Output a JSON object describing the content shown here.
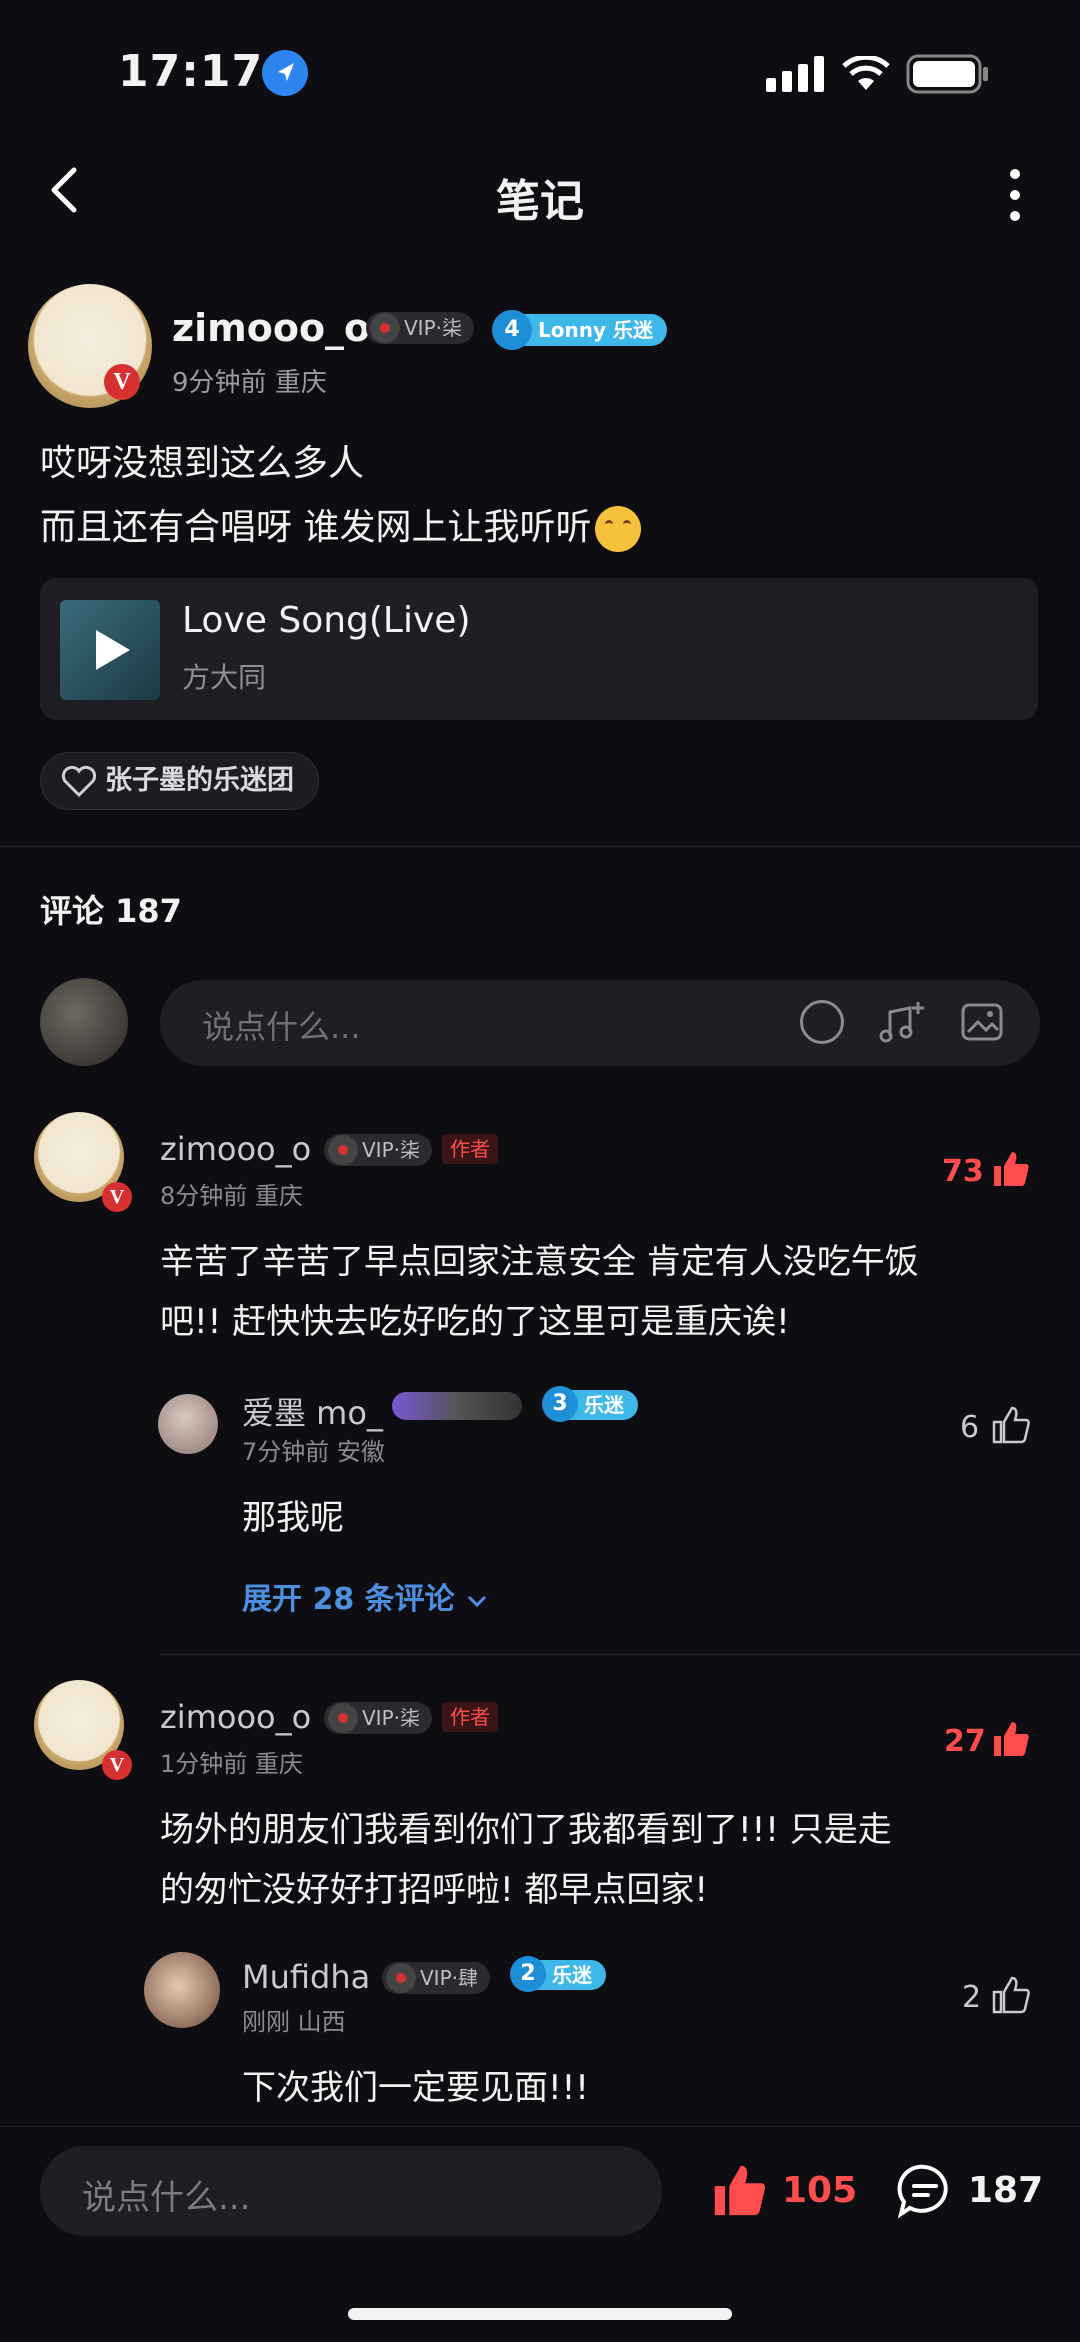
{
  "status_bar": {
    "time": "17:17"
  },
  "nav": {
    "title": "笔记"
  },
  "post": {
    "author": "zimooo_o",
    "vip": "VIP·柒",
    "fan_level": "4",
    "fan_label": "Lonny 乐迷",
    "time": "9分钟前",
    "location": "重庆",
    "line1": "哎呀没想到这么多人",
    "line2": "而且还有合唱呀 谁发网上让我听听",
    "song": {
      "name": "Love Song(Live)",
      "artist": "方大同"
    },
    "fan_group": "张子墨的乐迷团"
  },
  "comments_header": {
    "label": "评论 187"
  },
  "comment_input": {
    "placeholder": "说点什么..."
  },
  "comments": [
    {
      "author": "zimooo_o",
      "vip": "VIP·柒",
      "tag": "作者",
      "time": "8分钟前",
      "location": "重庆",
      "likes": "73",
      "line1": "辛苦了辛苦了早点回家注意安全 肯定有人没吃午饭",
      "line2": "吧!! 赶快快去吃好吃的了这里可是重庆诶!",
      "reply": {
        "author": "爱墨 mo_",
        "fan_level": "3",
        "fan_label": "乐迷",
        "time": "7分钟前",
        "location": "安徽",
        "likes": "6",
        "text": "那我呢"
      },
      "expand": "展开 28 条评论"
    },
    {
      "author": "zimooo_o",
      "vip": "VIP·柒",
      "tag": "作者",
      "time": "1分钟前",
      "location": "重庆",
      "likes": "27",
      "line1": "场外的朋友们我看到你们了我都看到了!!! 只是走",
      "line2": "的匆忙没好好打招呼啦! 都早点回家!",
      "reply": {
        "author": "Mufidha",
        "vip": "VIP·肆",
        "fan_level": "2",
        "fan_label": "乐迷",
        "time": "刚刚",
        "location": "山西",
        "likes": "2",
        "text": "下次我们一定要见面!!!"
      }
    }
  ],
  "bottom_bar": {
    "placeholder": "说点什么...",
    "likes": "105",
    "comments": "187"
  },
  "colors": {
    "accent_red": "#ff4d4d",
    "link_blue": "#4d8fe0",
    "fan_blue": "#3db8e8",
    "background": "#0d0d12"
  }
}
